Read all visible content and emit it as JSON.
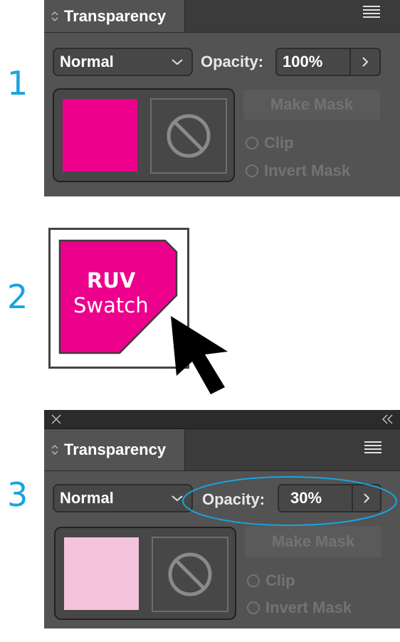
{
  "steps": [
    "1",
    "2",
    "3"
  ],
  "panel1": {
    "title": "Transparency",
    "blend_mode": "Normal",
    "opacity_label": "Opacity:",
    "opacity_value": "100%",
    "make_mask": "Make Mask",
    "clip": "Clip",
    "invert_mask": "Invert Mask",
    "swatch_color": "#ec008c"
  },
  "swatch": {
    "line1": "RUV",
    "line2": "Swatch",
    "color": "#ec008c"
  },
  "panel3": {
    "title": "Transparency",
    "blend_mode": "Normal",
    "opacity_label": "Opacity:",
    "opacity_value": "30%",
    "make_mask": "Make Mask",
    "clip": "Clip",
    "invert_mask": "Invert Mask",
    "swatch_color": "#f4c3dc",
    "highlight_color": "#1aa3e0"
  },
  "icons": [
    "sort-arrows-icon",
    "panel-menu-icon",
    "chevron-down-icon",
    "chevron-right-icon",
    "no-mask-icon",
    "close-icon",
    "collapse-icon",
    "cursor-arrow-icon"
  ]
}
